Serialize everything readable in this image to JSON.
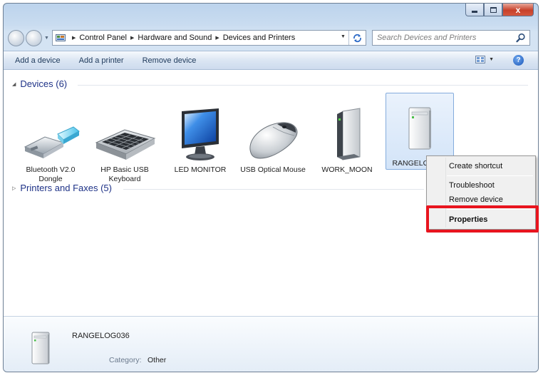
{
  "window": {
    "caption_close": "x"
  },
  "breadcrumb": {
    "items": [
      "Control Panel",
      "Hardware and Sound",
      "Devices and Printers"
    ]
  },
  "search": {
    "placeholder": "Search Devices and Printers"
  },
  "toolbar": {
    "add_device": "Add a device",
    "add_printer": "Add a printer",
    "remove_device": "Remove device",
    "help": "?"
  },
  "groups": {
    "devices": "Devices (6)",
    "printers": "Printers and Faxes (5)"
  },
  "devices": [
    {
      "name": "Bluetooth V2.0 Dongle",
      "icon": "usb-dongle-icon"
    },
    {
      "name": "HP Basic USB Keyboard",
      "icon": "keyboard-icon"
    },
    {
      "name": "LED MONITOR",
      "icon": "monitor-icon"
    },
    {
      "name": "USB Optical Mouse",
      "icon": "mouse-icon"
    },
    {
      "name": "WORK_MOON",
      "icon": "computer-tower-icon"
    },
    {
      "name": "RANGELOG036",
      "icon": "computer-tower-icon",
      "selected": true
    }
  ],
  "context_menu": {
    "items": [
      "Create shortcut",
      "Troubleshoot",
      "Remove device",
      "Properties"
    ],
    "highlighted": "Properties"
  },
  "details": {
    "name": "RANGELOG036",
    "category_label": "Category:",
    "category_value": "Other"
  },
  "colors": {
    "accent_red": "#e8141e",
    "group_title": "#1e3287",
    "selection_border": "#84acdd"
  }
}
